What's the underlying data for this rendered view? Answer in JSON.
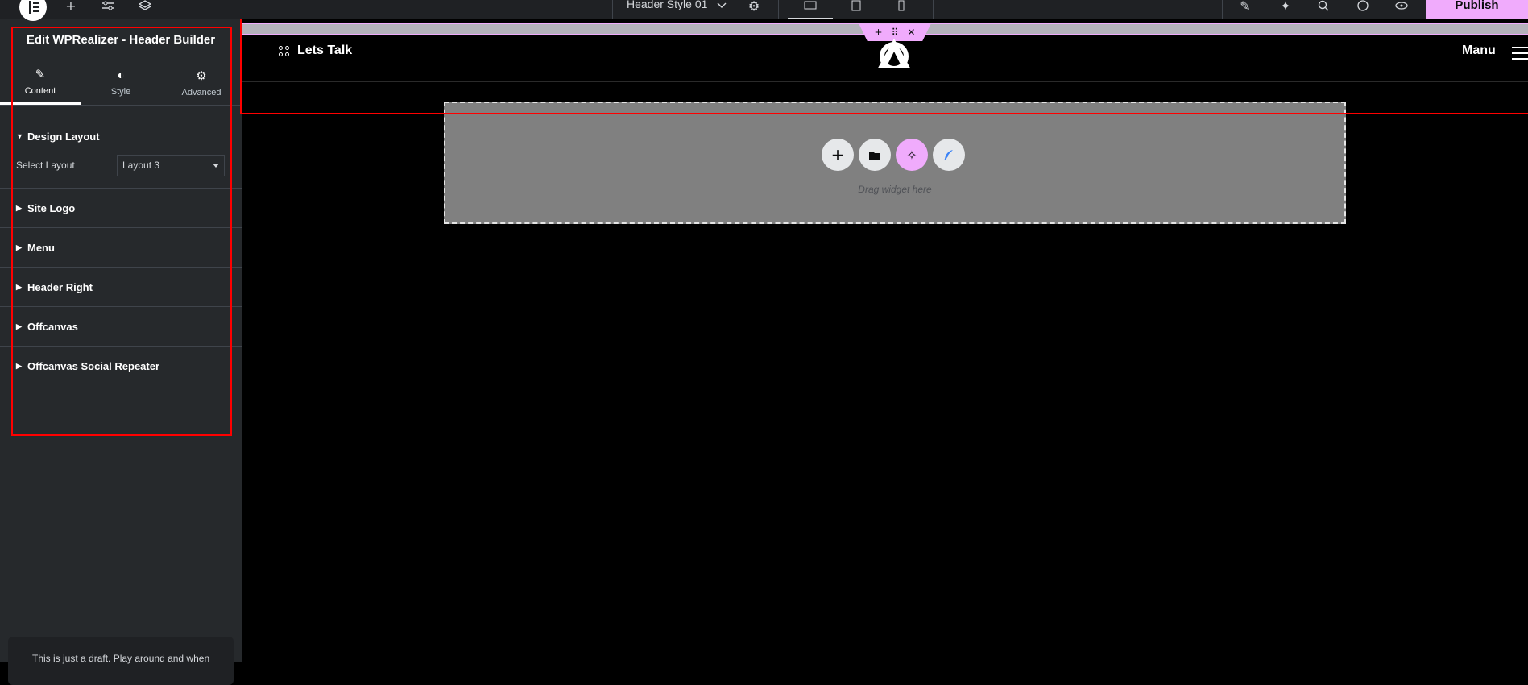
{
  "topbar": {
    "document_title": "Header Style 01",
    "publish_label": "Publish"
  },
  "panel": {
    "title": "Edit WPRealizer - Header Builder",
    "tabs": [
      {
        "label": "Content",
        "icon": "pencil-icon",
        "active": true
      },
      {
        "label": "Style",
        "icon": "half-circle-icon",
        "active": false
      },
      {
        "label": "Advanced",
        "icon": "gear-icon",
        "active": false
      }
    ],
    "sections": [
      {
        "label": "Design Layout",
        "open": true
      },
      {
        "label": "Site Logo",
        "open": false
      },
      {
        "label": "Menu",
        "open": false
      },
      {
        "label": "Header Right",
        "open": false
      },
      {
        "label": "Offcanvas",
        "open": false
      },
      {
        "label": "Offcanvas Social Repeater",
        "open": false
      }
    ],
    "select_layout": {
      "label": "Select Layout",
      "value": "Layout 3"
    },
    "draft_notice": "This is just a draft. Play around and when"
  },
  "canvas": {
    "lets_talk": "Lets Talk",
    "menu_label": "Manu",
    "drop_zone_text": "Drag widget here"
  },
  "colors": {
    "accent": "#f0abfc",
    "highlight": "#ff0000",
    "panel_bg": "#26292c"
  }
}
